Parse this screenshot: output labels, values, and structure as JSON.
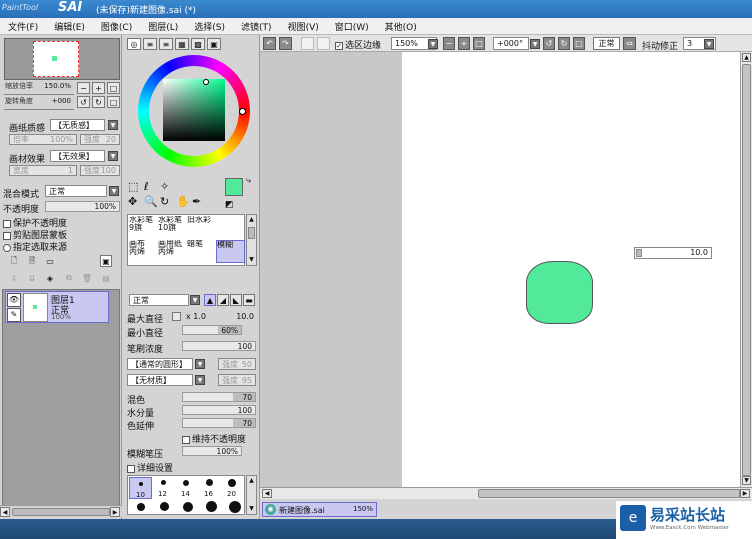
{
  "window": {
    "logo_small": "PaintTool",
    "logo_big": "SAI",
    "title": "(未保存)新建图像.sai (*)"
  },
  "menu": [
    "文件(F)",
    "编辑(E)",
    "图像(C)",
    "图层(L)",
    "选择(S)",
    "滤镜(T)",
    "视图(V)",
    "窗口(W)",
    "其他(O)"
  ],
  "navigator": {
    "zoom_label": "缩放倍率",
    "zoom_value": "150.0%",
    "rotate_label": "旋转角度",
    "rotate_value": "+000"
  },
  "paper": {
    "texture_label": "画纸质感",
    "texture_value": "【无质感】",
    "scale_label": "倍率",
    "scale_value": "100%",
    "strength_label": "强度",
    "strength_value": "20",
    "effect_label": "画材效果",
    "effect_value": "【无效果】",
    "width_label": "宽度",
    "width_value": "1",
    "intensity_label": "强度",
    "intensity_value": "100"
  },
  "layer_props": {
    "blend_label": "混合模式",
    "blend_value": "正常",
    "opacity_label": "不透明度",
    "opacity_value": "100%",
    "opacity_fraction": 1.0,
    "preserve_opacity": "保护不透明度",
    "clip_group": "剪贴图层蒙板",
    "selection_source": "指定选取来源"
  },
  "layers": [
    {
      "name": "图层1",
      "mode": "正常",
      "opacity": "100%"
    }
  ],
  "colors": {
    "primary": "#52e99b",
    "accent_selected": "#c8c8f0",
    "canvas_bg": "#ffffff",
    "workspace_bg": "#c8c8c8"
  },
  "tools": [
    {
      "name": "水彩笔",
      "sub": "9旗"
    },
    {
      "name": "水彩笔",
      "sub": "10旗"
    },
    {
      "name": "旧水彩",
      "sub": ""
    },
    {
      "name": "",
      "sub": ""
    },
    {
      "name": "画布",
      "sub": "丙烯"
    },
    {
      "name": "画用纸",
      "sub": "丙烯"
    },
    {
      "name": "蜡笔",
      "sub": ""
    },
    {
      "name": "模糊",
      "sub": ""
    }
  ],
  "brush": {
    "mode_value": "正常",
    "max_size_label": "最大直径",
    "max_size_mult": "x 1.0",
    "max_size_value": "10.0",
    "min_size_label": "最小直径",
    "min_size_value": "60%",
    "min_size_fraction": 0.6,
    "density_label": "笔刷浓度",
    "density_value": "100",
    "density_fraction": 1.0,
    "shape_value": "【通常的圆形】",
    "shape_strength_label": "强度",
    "shape_strength_value": "50",
    "texture_value": "【无材质】",
    "texture_strength_label": "强度",
    "texture_strength_value": "95",
    "blend_label": "混色",
    "blend_value": "70",
    "blend_fraction": 0.7,
    "water_label": "水分量",
    "water_value": "100",
    "water_fraction": 1.0,
    "persistence_label": "色延伸",
    "persistence_value": "70",
    "persistence_fraction": 0.7,
    "keep_opacity_label": "维持不透明度",
    "blur_pressure_label": "模糊笔压",
    "blur_pressure_value": "100%",
    "blur_pressure_fraction": 1.0,
    "detail_label": "详细设置"
  },
  "brush_sizes": [
    "10",
    "12",
    "14",
    "16",
    "20"
  ],
  "toolbar": {
    "selection_edge": "选区边缘",
    "zoom_value": "150%",
    "rotation_value": "+000°",
    "normal_label": "正常",
    "stabilizer_label": "抖动修正",
    "stabilizer_value": "3"
  },
  "canvas_popup_value": "10.0",
  "status": {
    "doc_name": "新建图像.sai",
    "doc_zoom": "150%"
  },
  "watermark": {
    "brand": "易采站长站",
    "sub": "Www.Easck.Com Webmaster"
  }
}
